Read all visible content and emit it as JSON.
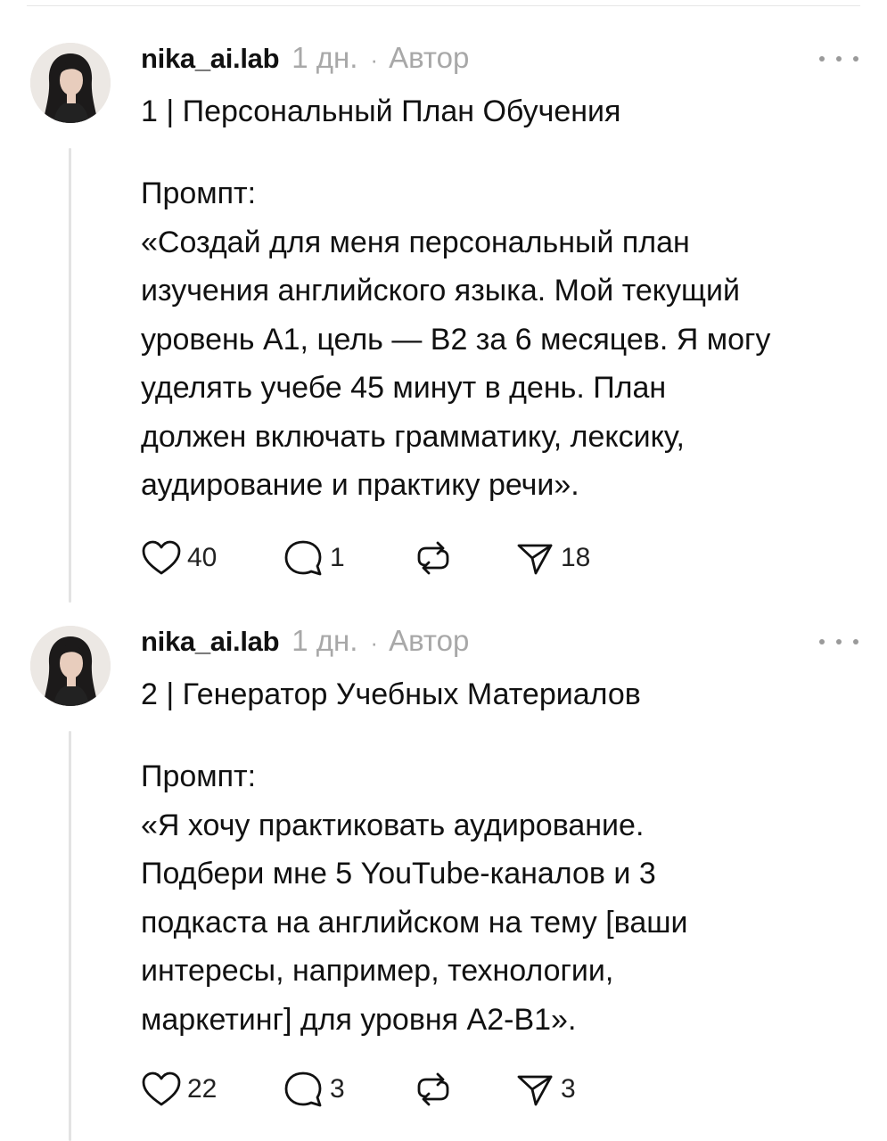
{
  "posts": [
    {
      "username": "nika_ai.lab",
      "time": "1 дн.",
      "separator": "·",
      "author_label": "Автор",
      "title": "1 | Персональный План Обучения",
      "prompt_label": "Промпт:",
      "prompt_text": "«Создай для меня персональный план\nизучения английского языка. Мой текущий\nуровень А1, цель — В2 за 6 месяцев. Я могу\nуделять учебе 45 минут в день. План\nдолжен включать грамматику, лексику,\nаудирование и практику речи».",
      "likes": "40",
      "replies": "1",
      "shares": "18"
    },
    {
      "username": "nika_ai.lab",
      "time": "1 дн.",
      "separator": "·",
      "author_label": "Автор",
      "title": "2 | Генератор Учебных Материалов",
      "prompt_label": "Промпт:",
      "prompt_text": "«Я хочу практиковать аудирование.\nПодбери мне 5 YouTube-каналов и 3\nподкаста на английском на тему [ваши\nинтересы, например, технологии,\nмаркетинг] для уровня А2-В1».",
      "likes": "22",
      "replies": "3",
      "shares": "3"
    }
  ],
  "icons": {
    "like": "heart-icon",
    "reply": "comment-icon",
    "repost": "repost-icon",
    "share": "send-icon",
    "more": "more-horizontal-icon"
  },
  "colors": {
    "text": "#111111",
    "muted": "#a8a8a8",
    "thread_line": "#e3e3e3",
    "background": "#ffffff"
  }
}
